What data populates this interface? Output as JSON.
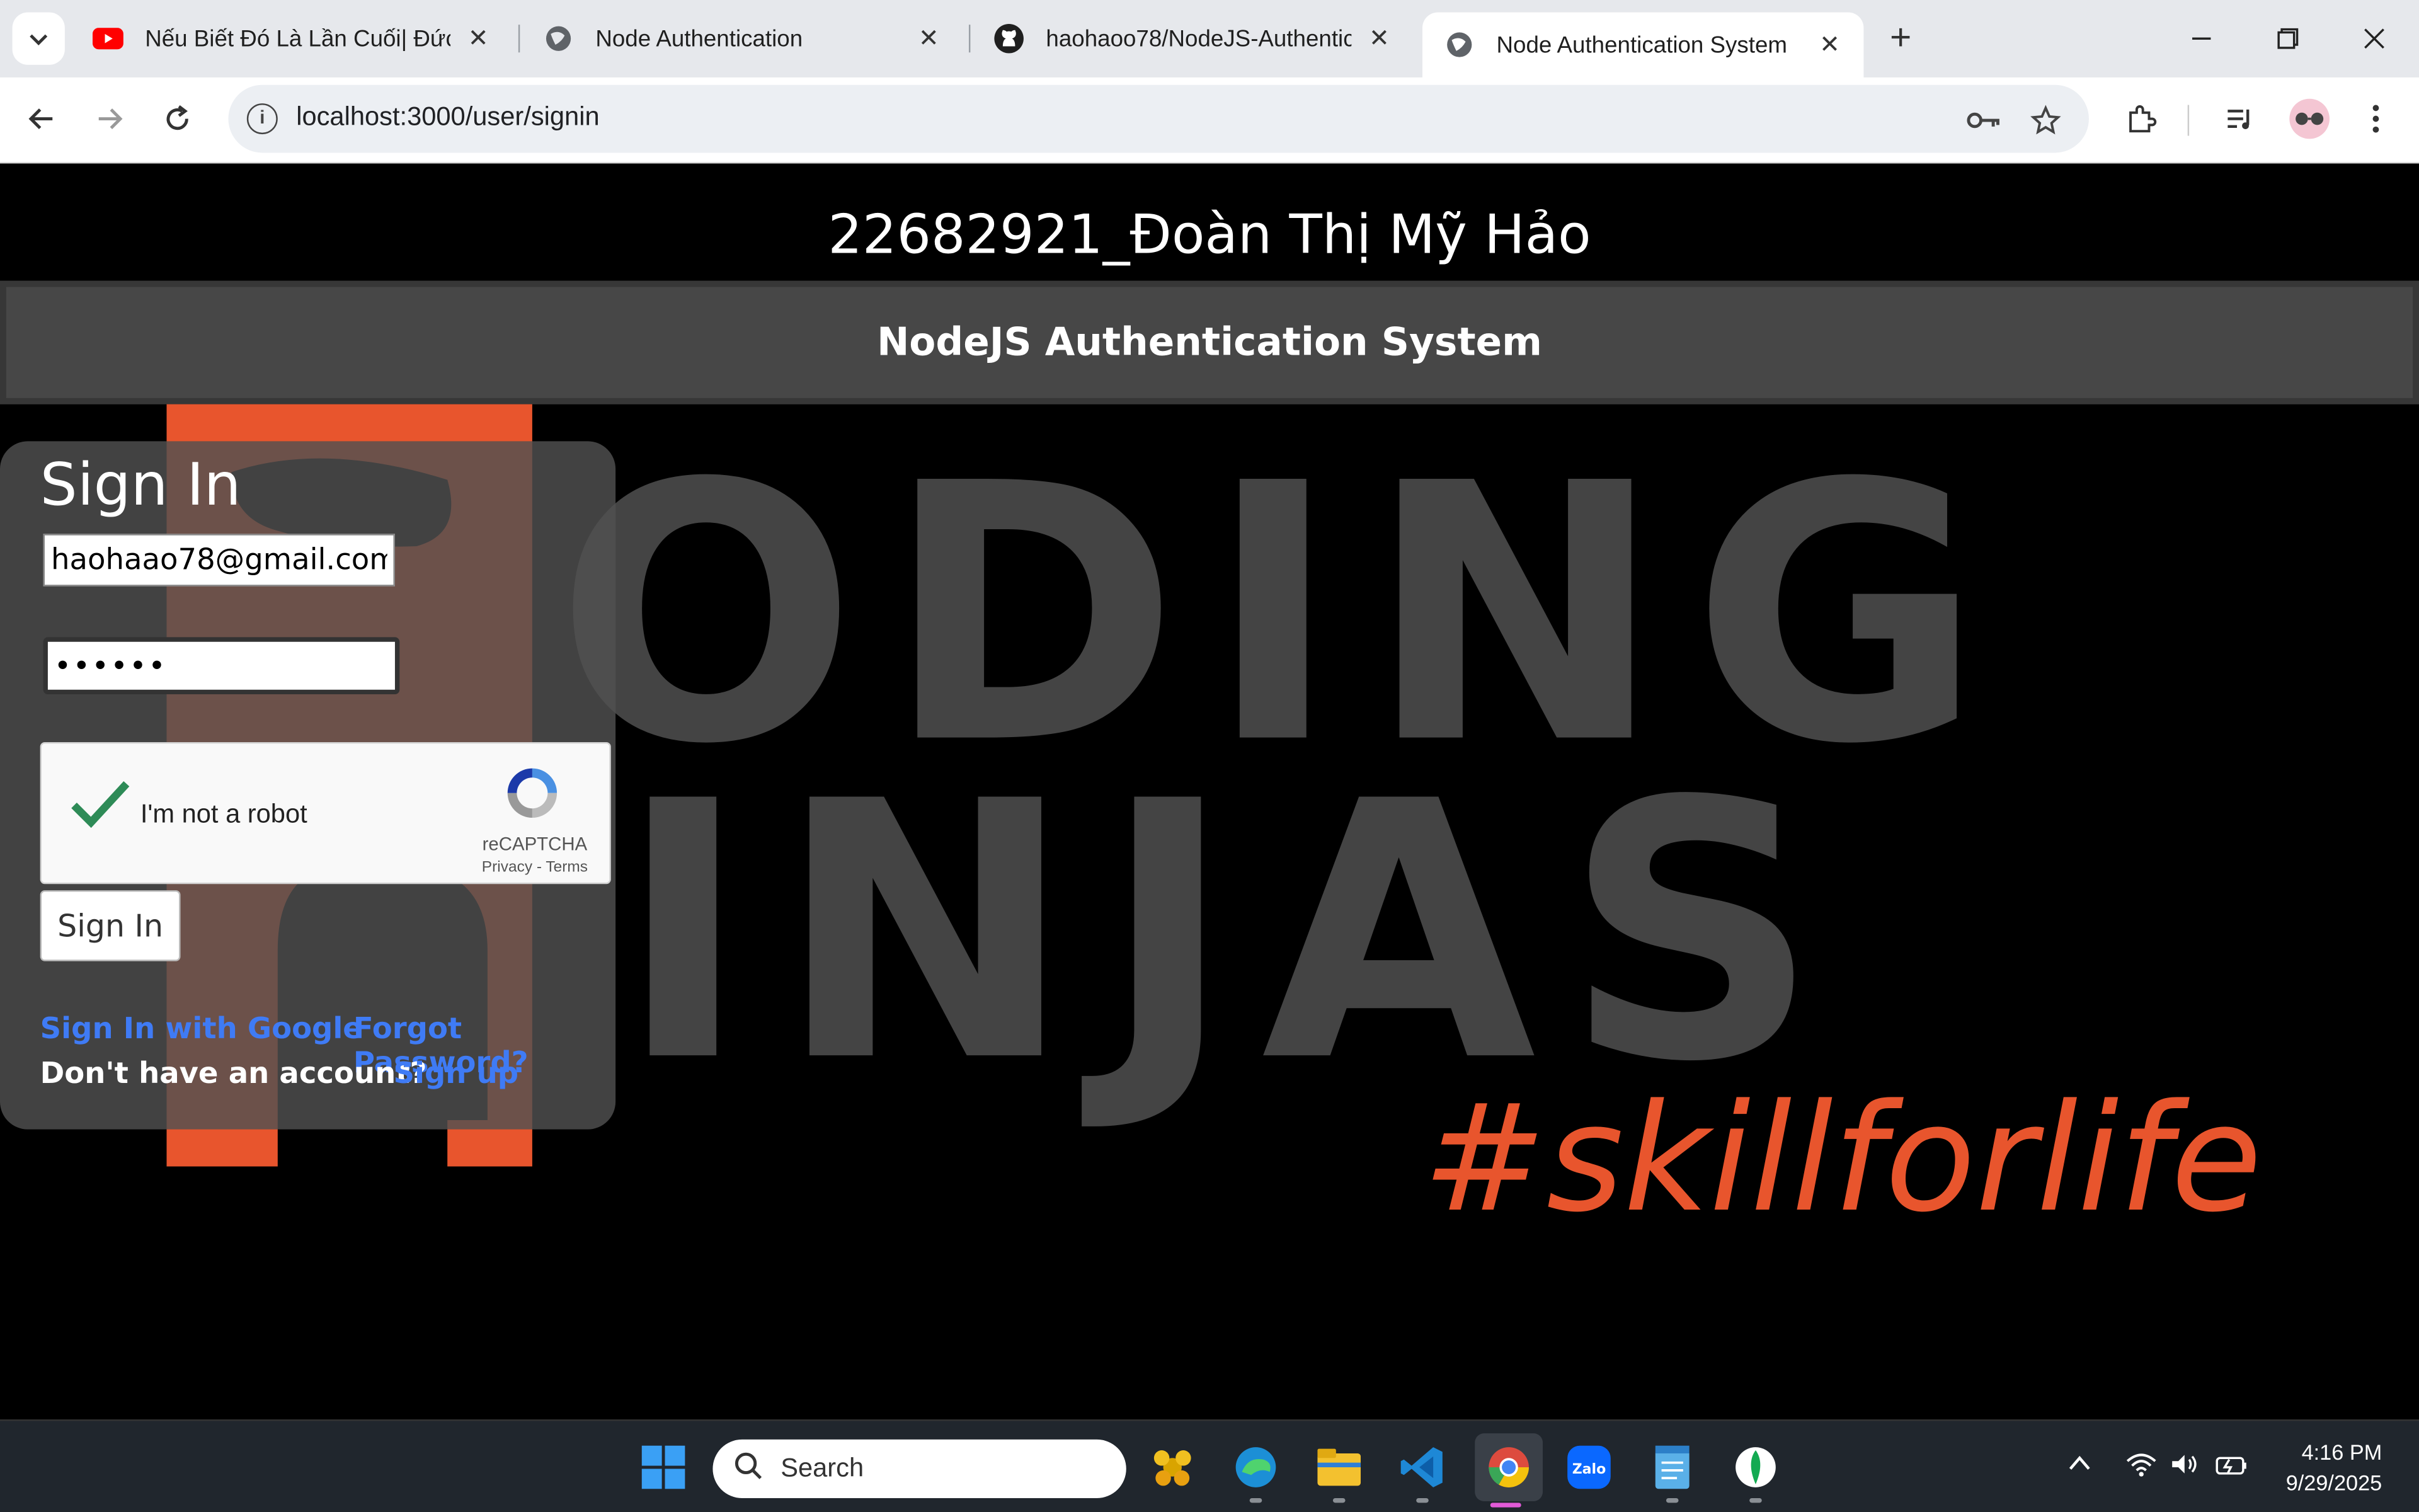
{
  "browser": {
    "tabs": [
      {
        "title": "Nếu Biết Đó Là Lần Cuối| Đức Tr",
        "favicon": "youtube-icon",
        "active": false
      },
      {
        "title": "Node Authentication",
        "favicon": "globe-icon",
        "active": false
      },
      {
        "title": "haohaoo78/NodeJS-Authentica",
        "favicon": "github-icon",
        "active": false
      },
      {
        "title": "Node Authentication System",
        "favicon": "globe-icon",
        "active": true
      }
    ],
    "new_tab": "+",
    "url": "localhost:3000/user/signin"
  },
  "page": {
    "header_title": "22682921_Đoàn Thị Mỹ Hảo",
    "nav_title": "NodeJS Authentication System",
    "background": {
      "brand_top": "ODING",
      "brand_bottom": "INJAS",
      "tagline": "#skillforlife",
      "accent_color": "#e8552d"
    },
    "signin": {
      "heading": "Sign In",
      "email_value": "haohaao78@gmail.com",
      "password_value": "••••••",
      "recaptcha": {
        "label": "I'm not a robot",
        "brand": "reCAPTCHA",
        "links": "Privacy - Terms"
      },
      "submit_label": "Sign In",
      "google_link": "Sign In with Google",
      "forgot_link": "Forgot Password?",
      "no_account_text": "Don't have an account?",
      "signup_link": "Sign up"
    }
  },
  "taskbar": {
    "search_placeholder": "Search",
    "time": "4:16 PM",
    "date": "9/29/2025"
  }
}
